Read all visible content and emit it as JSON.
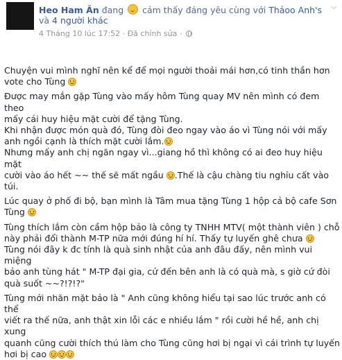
{
  "header": {
    "author": "Heo Ham Ăn",
    "status_pre": " đang ",
    "status_feeling": " cảm thấy đáng yêu cùng với ",
    "tagged_friend": "Thảoo Anh's",
    "and_text": "và",
    "others": "4 người khác",
    "timestamp": "4 Tháng 10 lúc 17:52",
    "separator": " · ",
    "edited": "Đã chỉnh sửa",
    "separator2": " · "
  },
  "icons": {
    "feeling": "smiling-face-icon",
    "privacy": "globe-icon",
    "options": "chevron-down-icon",
    "inline": "smile-emoji-icon"
  },
  "post": {
    "p1": "Chuyện vui mình nghĩ nên kể để mọi người thoải mái hơn,có tinh thần hơn\nvote cho Tùng ",
    "p2a": "Được may mắn gặp Tùng vào mấy hôm Tùng quay MV nên mình có đem theo\nmấy cái huy hiệu mặt cười để tặng Tùng.",
    "p2b": "Khi nhận được món quà đó, Tùng đòi đeo ngay vào áo vì Tùng nói với mấy\nanh ngồi cạnh là thích mặt cười lắm.",
    "p2c1": "Nhưng mấy anh chị ngăn ngay vì...giang hồ thì không có ai đeo huy hiệu mặt\ncười vào áo hết ~~ thế sẽ mất ngầu ",
    "p2c2": ".Thế là cậu chàng tiu nghỉu cất vào túi.",
    "p3": "Lúc quay ở phố đi bộ, bạn mình là Tâm mua tặng Tùng 1 hộp cả bộ cafe Sơn\nTùng ",
    "p4a": "Tùng thích lắm còn cầm hộp bảo là công ty TNHH MTV( một thành viên ) chỗ\nnày phải đổi thành M-TP nữa mới đúng hí hí. Thấy tự luyến ghê chưa ",
    "p4b": "Tùng nói đây k đc tính là quà sinh nhật của anh đâu đấy, nên mình vui miệng\nbảo anh tùng hát \" M-TP đại gia, cứ đến bên anh là có quà mà, s giờ cứ đòi\nquà suốt ~~?!?!?\"",
    "p5": "Tùng mới nhăn mặt bảo là \" Anh cũng không hiểu tại sao lúc trước anh có thể\nviết ra thế nữa, anh thật xin lỗi các e nhiều lắm \" rồi cười hề hề, anh chị xung\nquanh cũng cười thích thú làm cho Tùng cũng hơi bị ngại vì cái trình tự luyến\nhơi bị cao "
  }
}
